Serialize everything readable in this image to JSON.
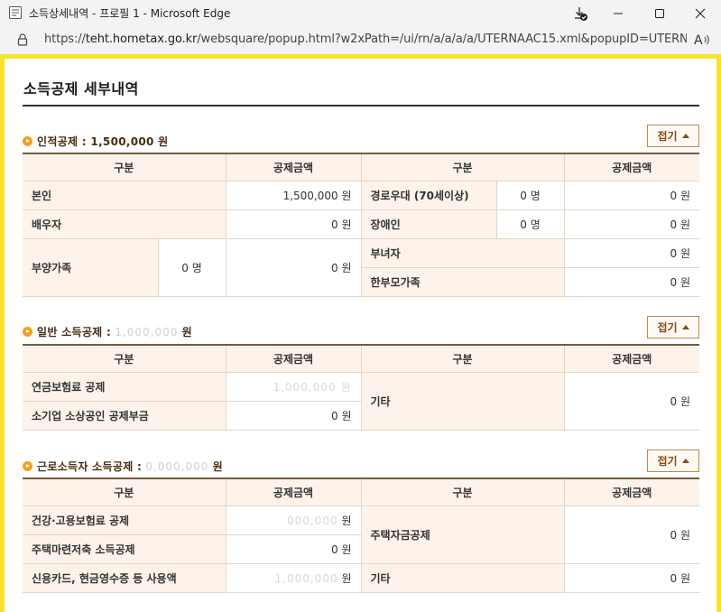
{
  "window": {
    "title": "소득상세내역 - 프로필 1 - Microsoft Edge",
    "url_prefix": "https://",
    "url_host": "teht.hometax.go.kr",
    "url_rest": "/websquare/popup.html?w2xPath=/ui/rn/a/a/a/a/UTERNAAC15.xml&popupID=UTERN..."
  },
  "page": {
    "title": "소득공제 세부내역"
  },
  "fold_label": "접기",
  "headers": {
    "category": "구분",
    "amount": "공제금액"
  },
  "section1": {
    "title": "인적공제 : 1,500,000 원",
    "rows": {
      "self_label": "본인",
      "self_amount": "1,500,000 원",
      "elderly_label": "경로우대 (70세이상)",
      "elderly_count": "0 명",
      "elderly_amount": "0 원",
      "spouse_label": "배우자",
      "spouse_amount": "0 원",
      "disabled_label": "장애인",
      "disabled_count": "0 명",
      "disabled_amount": "0 원",
      "dependent_label": "부양가족",
      "dependent_count": "0 명",
      "dependent_amount": "0 원",
      "woman_label": "부녀자",
      "woman_amount": "0 원",
      "single_parent_label": "한부모가족",
      "single_parent_amount": "0 원"
    }
  },
  "section2": {
    "title_prefix": "일반 소득공제 :",
    "title_masked": "1,000,000",
    "title_suffix": "원",
    "rows": {
      "pension_label": "연금보험료 공제",
      "pension_amount": "1,000,000 원",
      "small_biz_label": "소기업 소상공인 공제부금",
      "small_biz_amount": "0 원",
      "other_label": "기타",
      "other_amount": "0 원"
    }
  },
  "section3": {
    "title_prefix": "근로소득자 소득공제 :",
    "title_masked": "0,000,000",
    "title_suffix": "원",
    "rows": {
      "health_label": "건강·고용보험료 공제",
      "health_amount_masked": "000,000",
      "health_amount_unit": "원",
      "housing_savings_label": "주택마련저축 소득공제",
      "housing_savings_amount": "0 원",
      "card_label": "신용카드, 현금영수증 등 사용액",
      "card_amount_masked": "1,000,000",
      "card_amount_unit": "원",
      "housing_fund_label": "주택자금공제",
      "housing_fund_amount": "0 원",
      "other_label": "기타",
      "other_amount": "0 원"
    }
  },
  "colors": {
    "frame": "#f7e22a",
    "header_bg": "#fdf3ea",
    "accent": "#f2a31b",
    "fold_border": "#c0884e"
  }
}
